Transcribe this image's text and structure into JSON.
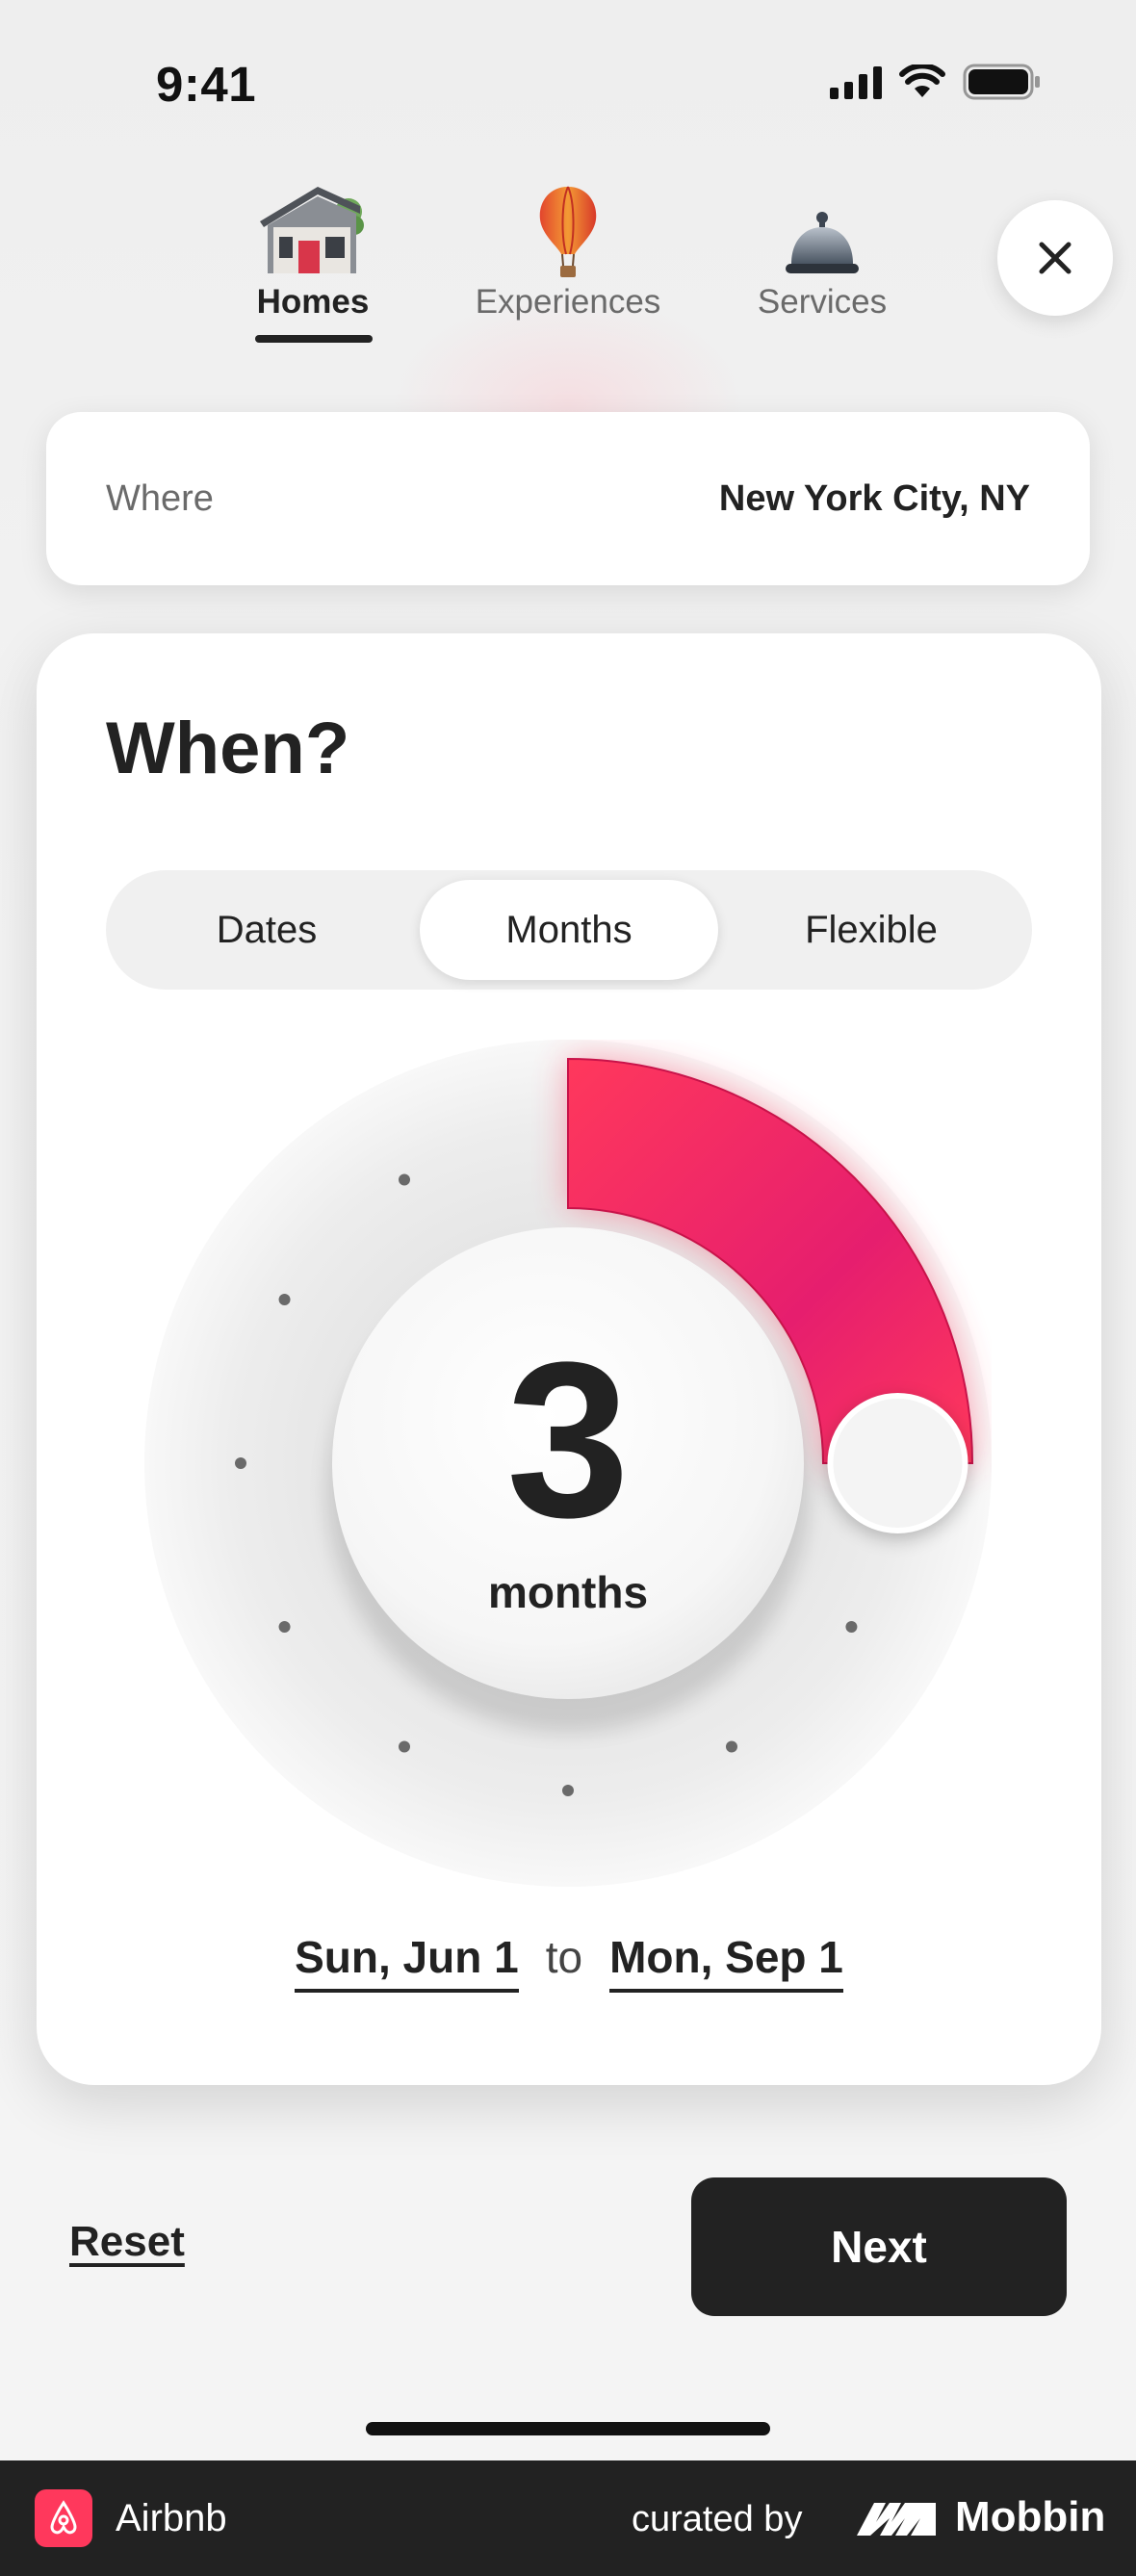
{
  "status_bar": {
    "time": "9:41"
  },
  "tabs": [
    {
      "label": "Homes",
      "icon": "house-icon",
      "active": true
    },
    {
      "label": "Experiences",
      "icon": "hot-air-balloon-icon",
      "active": false
    },
    {
      "label": "Services",
      "icon": "service-bell-icon",
      "active": false
    }
  ],
  "close_icon": "close-icon",
  "where": {
    "label": "Where",
    "value": "New York City, NY"
  },
  "when": {
    "title": "When?",
    "segments": [
      "Dates",
      "Months",
      "Flexible"
    ],
    "selected_segment": "Months",
    "dial": {
      "value": "3",
      "unit": "months",
      "selected_months": 3,
      "max_months": 12
    },
    "start_date": "Sun, Jun 1",
    "to_label": "to",
    "end_date": "Mon, Sep 1"
  },
  "footer": {
    "reset_label": "Reset",
    "next_label": "Next"
  },
  "brand_bar": {
    "app_name": "Airbnb",
    "curated_by": "curated by",
    "curator": "Mobbin"
  },
  "colors": {
    "accent": "#FF385C",
    "dark": "#222222",
    "brand_bar": "#222222"
  }
}
